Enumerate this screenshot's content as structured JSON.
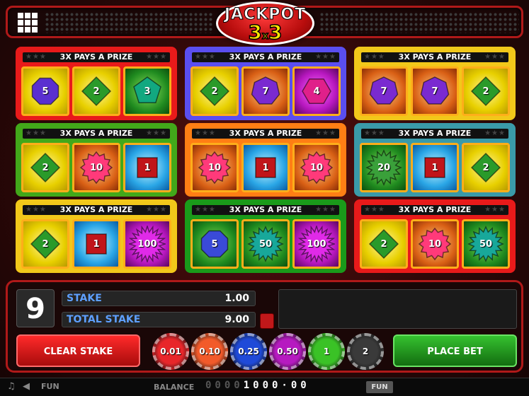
{
  "header": {
    "logo_top": "JACKPOT",
    "logo_left": "3",
    "logo_x": "x",
    "logo_right": "3"
  },
  "cards": [
    {
      "header": "3X PAYS A PRIZE",
      "border": "#e81a1a",
      "cells": [
        {
          "bg": "yellow",
          "shape": "octagon",
          "color": "#5a2fd0",
          "value": "5"
        },
        {
          "bg": "yellow",
          "shape": "diamond",
          "color": "#2a9a2a",
          "value": "2"
        },
        {
          "bg": "green",
          "shape": "pentagon",
          "color": "#12a880",
          "value": "3"
        }
      ]
    },
    {
      "header": "3X PAYS A PRIZE",
      "border": "#5a4ef0",
      "cells": [
        {
          "bg": "yellow",
          "shape": "diamond",
          "color": "#2a9a2a",
          "value": "2"
        },
        {
          "bg": "orange",
          "shape": "heptagon",
          "color": "#7a2ad0",
          "value": "7"
        },
        {
          "bg": "purple",
          "shape": "hexagon",
          "color": "#e0208a",
          "value": "4"
        }
      ]
    },
    {
      "header": "3X PAYS A PRIZE",
      "border": "#f2c81a",
      "cells": [
        {
          "bg": "orange",
          "shape": "heptagon",
          "color": "#7a2ad0",
          "value": "7"
        },
        {
          "bg": "orange",
          "shape": "heptagon",
          "color": "#7a2ad0",
          "value": "7"
        },
        {
          "bg": "yellow",
          "shape": "diamond",
          "color": "#2a9a2a",
          "value": "2"
        }
      ]
    },
    {
      "header": "3X PAYS A PRIZE",
      "border": "#42a81a",
      "cells": [
        {
          "bg": "yellow",
          "shape": "diamond",
          "color": "#2a9a2a",
          "value": "2"
        },
        {
          "bg": "orange",
          "shape": "star12",
          "color": "#ff3a7a",
          "value": "10"
        },
        {
          "bg": "blue",
          "shape": "square",
          "color": "#c0151a",
          "value": "1"
        }
      ]
    },
    {
      "header": "3X PAYS A PRIZE",
      "border": "#ff7e14",
      "cells": [
        {
          "bg": "orange",
          "shape": "star12",
          "color": "#ff3a7a",
          "value": "10"
        },
        {
          "bg": "blue",
          "shape": "square",
          "color": "#c0151a",
          "value": "1"
        },
        {
          "bg": "orange",
          "shape": "star12",
          "color": "#ff3a7a",
          "value": "10"
        }
      ]
    },
    {
      "header": "3X PAYS A PRIZE",
      "border": "#3a9aa8",
      "cells": [
        {
          "bg": "green",
          "shape": "star16",
          "color": "#3aa03a",
          "value": "20"
        },
        {
          "bg": "blue",
          "shape": "square",
          "color": "#c0151a",
          "value": "1"
        },
        {
          "bg": "yellow",
          "shape": "diamond",
          "color": "#2a9a2a",
          "value": "2"
        }
      ]
    },
    {
      "header": "3X PAYS A PRIZE",
      "border": "#f2c81a",
      "cells": [
        {
          "bg": "yellow",
          "shape": "diamond",
          "color": "#2a9a2a",
          "value": "2"
        },
        {
          "bg": "blue",
          "shape": "square",
          "color": "#c0151a",
          "value": "1"
        },
        {
          "bg": "purple",
          "shape": "star20",
          "color": "#e02ae8",
          "value": "100"
        }
      ]
    },
    {
      "header": "3X PAYS A PRIZE",
      "border": "#1a9a1a",
      "cells": [
        {
          "bg": "green",
          "shape": "octagon",
          "color": "#3a4ad8",
          "value": "5"
        },
        {
          "bg": "green",
          "shape": "star16",
          "color": "#18a89a",
          "value": "50"
        },
        {
          "bg": "purple",
          "shape": "star20",
          "color": "#e02ae8",
          "value": "100"
        }
      ]
    },
    {
      "header": "3X PAYS A PRIZE",
      "border": "#e81a1a",
      "cells": [
        {
          "bg": "yellow",
          "shape": "diamond",
          "color": "#2a9a2a",
          "value": "2"
        },
        {
          "bg": "orange",
          "shape": "star12",
          "color": "#ff3a7a",
          "value": "10"
        },
        {
          "bg": "green",
          "shape": "star16",
          "color": "#18a89a",
          "value": "50"
        }
      ]
    }
  ],
  "controls": {
    "lines": "9",
    "stake_label": "STAKE",
    "stake_value": "1.00",
    "total_stake_label": "TOTAL STAKE",
    "total_stake_value": "9.00",
    "clear_stake": "CLEAR STAKE",
    "place_bet": "PLACE BET",
    "chips": [
      {
        "label": "0.01",
        "color": "#e8262a"
      },
      {
        "label": "0.10",
        "color": "#f25a2a"
      },
      {
        "label": "0.25",
        "color": "#1f4ad8"
      },
      {
        "label": "0.50",
        "color": "#b61ac0"
      },
      {
        "label": "1",
        "color": "#3ac226"
      },
      {
        "label": "2",
        "color": "#3a3a3a"
      }
    ]
  },
  "footer": {
    "fun_label": "FUN",
    "balance_label": "BALANCE",
    "balance_dim": "0000",
    "balance_value": "1000·00",
    "mode_badge": "FUN",
    "music_icon": "music-note-icon",
    "sound_icon": "speaker-icon"
  }
}
